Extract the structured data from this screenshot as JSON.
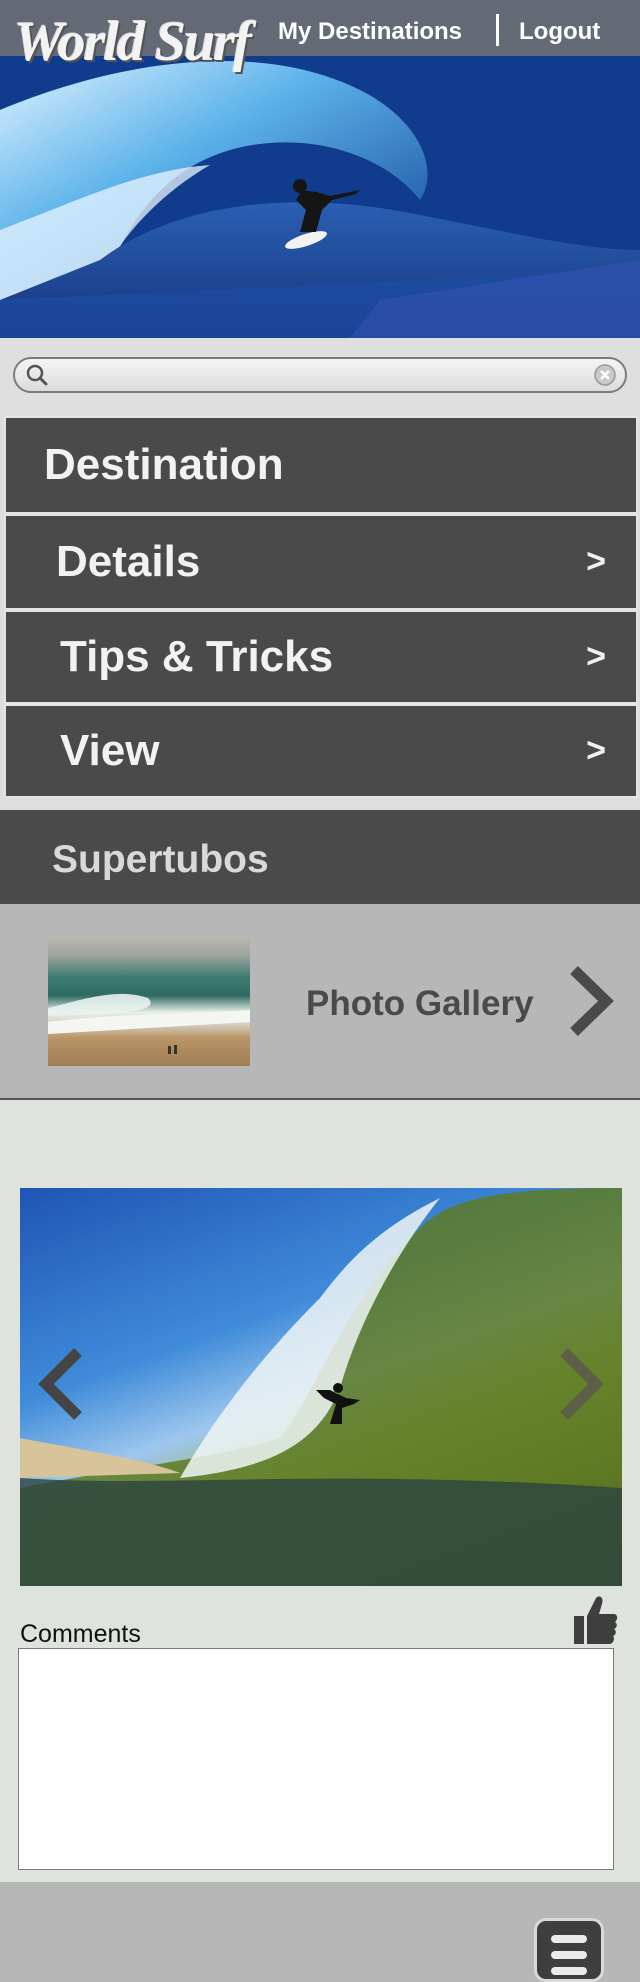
{
  "header": {
    "logo_text": "World Surf",
    "nav": {
      "my_destinations": "My Destinations",
      "logout": "Logout"
    }
  },
  "search": {
    "placeholder": "",
    "value": ""
  },
  "menu": {
    "title": "Destination",
    "items": [
      {
        "label": "Details",
        "chevron": ">"
      },
      {
        "label": "Tips & Tricks",
        "chevron": ">"
      },
      {
        "label": "View",
        "chevron": ">"
      }
    ]
  },
  "spot": {
    "name": "Supertubos",
    "gallery_label": "Photo Gallery"
  },
  "comments": {
    "label": "Comments",
    "value": ""
  },
  "icons": {
    "search": "search-icon",
    "clear": "clear-icon",
    "prev": "chevron-left-icon",
    "next": "chevron-right-icon",
    "like": "thumbs-up-icon",
    "menu": "hamburger-menu-icon"
  }
}
